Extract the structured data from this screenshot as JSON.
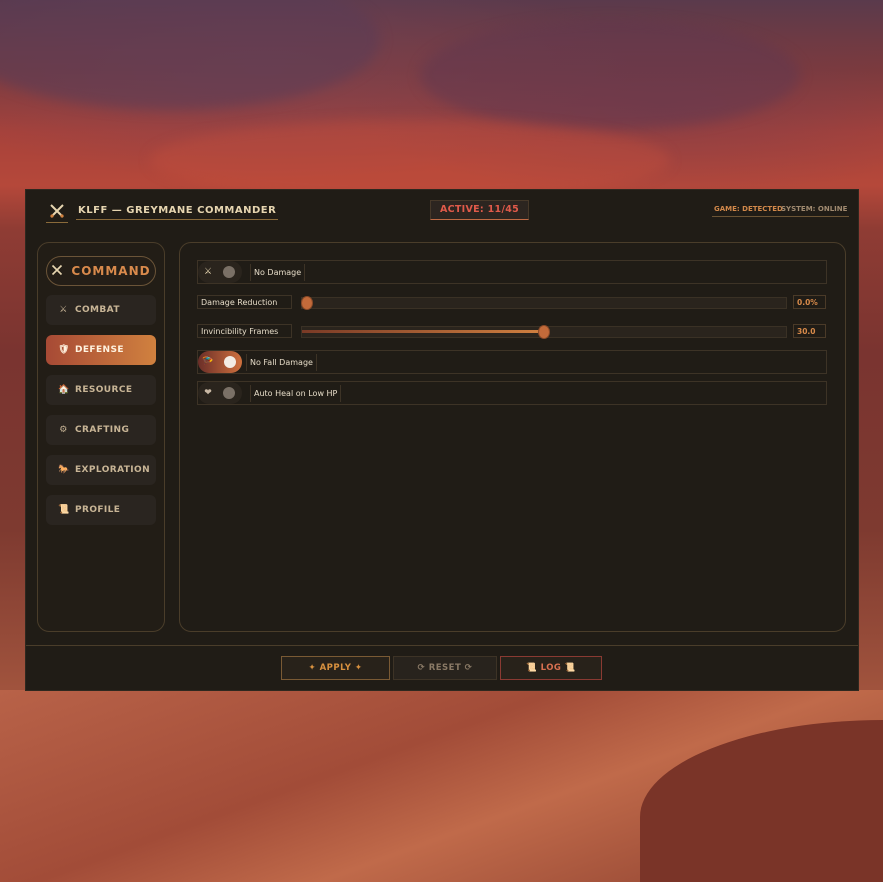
{
  "titlebar": {
    "title": "KLFF — GREYMANE COMMANDER",
    "active": "ACTIVE: 11/45",
    "game_status": "GAME: DETECTED",
    "system_status": "SYSTEM: ONLINE"
  },
  "sidebar": {
    "command_label": "COMMAND",
    "items": [
      {
        "label": "COMBAT",
        "icon": "⚔"
      },
      {
        "label": "DEFENSE",
        "icon": "🛡"
      },
      {
        "label": "RESOURCE",
        "icon": "🏠"
      },
      {
        "label": "CRAFTING",
        "icon": "⚙"
      },
      {
        "label": "EXPLORATION",
        "icon": "🐎"
      },
      {
        "label": "PROFILE",
        "icon": "📜"
      }
    ],
    "active_item": "DEFENSE"
  },
  "main": {
    "toggles": [
      {
        "label": "No Damage",
        "state": "off",
        "icon": "⚔"
      },
      {
        "label": "No Fall Damage",
        "state": "on",
        "icon": "🪂"
      },
      {
        "label": "Auto Heal on Low HP",
        "state": "off",
        "icon": "❤"
      }
    ],
    "sliders": [
      {
        "label": "Damage Reduction",
        "value": "0.0%",
        "fraction": 0.0
      },
      {
        "label": "Invincibility Frames",
        "value": "30.0",
        "fraction": 0.5
      }
    ]
  },
  "footer": {
    "apply": "✦ APPLY ✦",
    "reset": "⟳ RESET ⟳",
    "log": "📜 LOG 📜"
  },
  "colors": {
    "accent": "#d0813f",
    "active_red": "#e05a4a",
    "panel": "#201c16"
  }
}
